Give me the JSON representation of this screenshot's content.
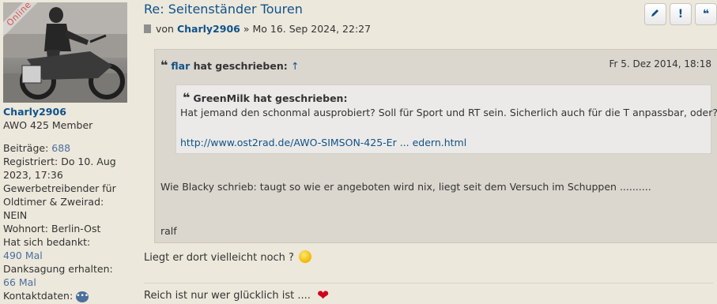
{
  "profile": {
    "online_label": "Online",
    "username": "Charly2906",
    "rank": "AWO 425 Member",
    "fields": [
      {
        "label": "Beiträge:",
        "value": "688"
      },
      {
        "label": "Registriert:",
        "value": "Do 10. Aug 2023, 17:36"
      },
      {
        "label": "Gewerbetreibender für Oldtimer & Zweirad:",
        "value": "NEIN"
      },
      {
        "label": "Wohnort:",
        "value": "Berlin-Ost"
      },
      {
        "label": "Hat sich bedankt:",
        "value": "490 Mal"
      },
      {
        "label": "Danksagung erhalten:",
        "value": "66 Mal"
      },
      {
        "label": "Kontaktdaten:",
        "value": ""
      }
    ]
  },
  "post": {
    "title": "Re: Seitenständer Touren",
    "author_prefix": "von",
    "author": "Charly2906",
    "date_sep": "»",
    "date": "Mo 16. Sep 2024, 22:27",
    "buttons": [
      {
        "name": "edit",
        "icon": "pencil"
      },
      {
        "name": "report",
        "icon": "!"
      },
      {
        "name": "quote",
        "icon": "quote"
      }
    ]
  },
  "quote": {
    "author": "flar",
    "wrote": "hat geschrieben:",
    "up_arrow": "↑",
    "date": "Fr 5. Dez 2014, 18:18",
    "inner": {
      "author": "GreenMilk",
      "wrote": "hat geschrieben:",
      "text": "Hat jemand den schonmal ausprobiert? Soll für Sport und RT sein. Sicherlich auch für die T anpassbar, oder?",
      "link": "http://www.ost2rad.de/AWO-SIMSON-425-Er ... edern.html"
    },
    "body": "Wie Blacky schrieb: taugt so wie er angeboten wird nix, liegt seit dem Versuch im Schuppen ..........",
    "signature": "ralf"
  },
  "post_text": "Liegt er dort vielleicht noch ?",
  "signature_text": "Reich ist nur wer glücklich ist ....",
  "colors": {
    "link": "#105289",
    "background": "#ece8dc",
    "online": "#d9534f",
    "heart": "#d0021b"
  }
}
